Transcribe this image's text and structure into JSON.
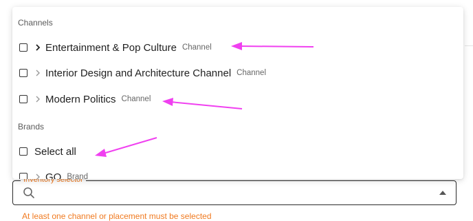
{
  "dropdown": {
    "channels_header": "Channels",
    "brands_header": "Brands",
    "channels": [
      {
        "label": "Entertainment & Pop Culture",
        "tag": "Channel"
      },
      {
        "label": "Interior Design and Architecture Channel",
        "tag": "Channel"
      },
      {
        "label": "Modern Politics",
        "tag": "Channel"
      }
    ],
    "select_all": "Select all",
    "brands": [
      {
        "label": "GQ",
        "tag": "Brand"
      }
    ]
  },
  "field": {
    "label": "Inventory selector",
    "error": "At least one channel or placement must be selected"
  },
  "colors": {
    "annotation_arrow": "#f040f0",
    "error": "#f07a20"
  }
}
